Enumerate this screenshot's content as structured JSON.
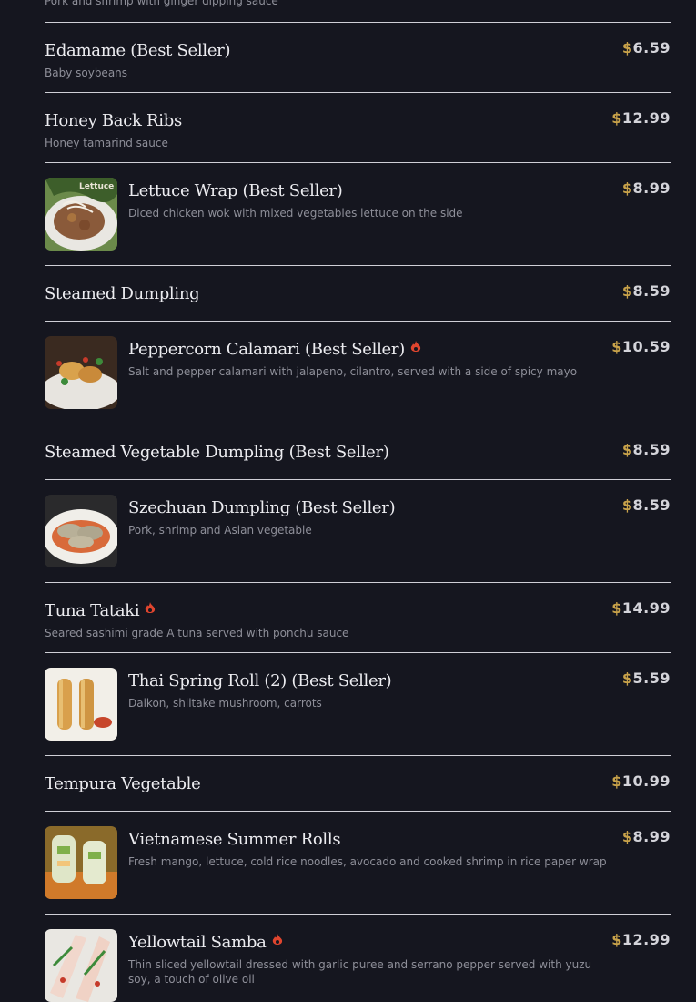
{
  "top_description": "Pork and shrimp with ginger dipping sauce",
  "currency": "$",
  "items": [
    {
      "name": "Edamame (Best Seller)",
      "desc": "Baby soybeans",
      "price": "6.59"
    },
    {
      "name": "Honey Back Ribs",
      "desc": "Honey tamarind sauce",
      "price": "12.99"
    },
    {
      "name": "Lettuce Wrap (Best Seller)",
      "desc": "Diced chicken wok with mixed vegetables lettuce on the side",
      "price": "8.99",
      "thumb_label": "Lettuce"
    },
    {
      "name": "Steamed Dumpling",
      "desc": "",
      "price": "8.59"
    },
    {
      "name": "Peppercorn Calamari (Best Seller)",
      "desc": "Salt and pepper calamari with jalapeno, cilantro, served with a side of spicy mayo",
      "price": "10.59",
      "spicy": true
    },
    {
      "name": "Steamed Vegetable Dumpling (Best Seller)",
      "desc": "",
      "price": "8.59"
    },
    {
      "name": "Szechuan Dumpling (Best Seller)",
      "desc": "Pork, shrimp and Asian vegetable",
      "price": "8.59"
    },
    {
      "name": "Tuna Tataki",
      "desc": "Seared sashimi grade A tuna served with ponchu sauce",
      "price": "14.99",
      "spicy": true
    },
    {
      "name": "Thai Spring Roll (2) (Best Seller)",
      "desc": "Daikon, shiitake mushroom, carrots",
      "price": "5.59"
    },
    {
      "name": "Tempura Vegetable",
      "desc": "",
      "price": "10.99"
    },
    {
      "name": "Vietnamese Summer Rolls",
      "desc": "Fresh mango, lettuce, cold rice noodles, avocado and cooked shrimp in rice paper wrap",
      "price": "8.99"
    },
    {
      "name": "Yellowtail Samba",
      "desc": "Thin sliced yellowtail dressed with garlic puree and serrano pepper served with yuzu soy, a touch of olive oil",
      "price": "12.99",
      "spicy": true
    }
  ],
  "icons": {
    "spicy": "flame-icon"
  },
  "colors": {
    "background": "#15161f",
    "currency": "#c8a24a",
    "spicy": "#e0452e",
    "divider": "#cfcfd6"
  }
}
